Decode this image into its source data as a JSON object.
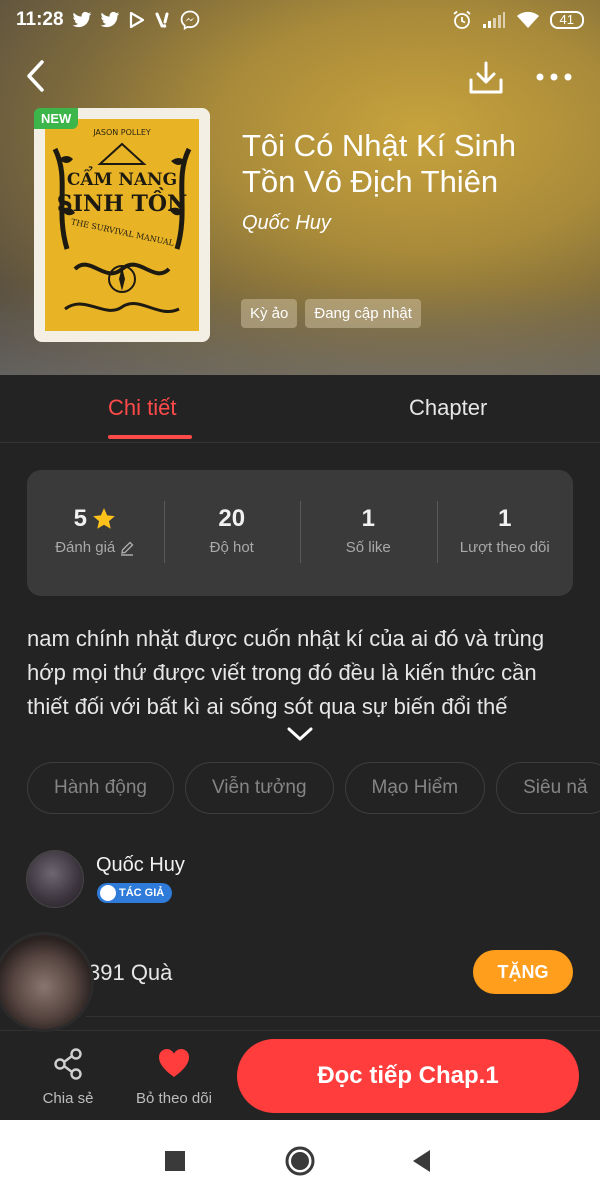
{
  "status_bar": {
    "time": "11:28",
    "battery": "41"
  },
  "book": {
    "badge": "NEW",
    "cover_author": "JASON POLLEY",
    "cover_title_1": "CẨM NANG",
    "cover_title_2": "SINH TỒN",
    "cover_subtitle": "THE SURVIVAL MANUAL",
    "title": "Tôi Có Nhật Kí Sinh Tồn Vô Địch Thiên",
    "author": "Quốc Huy",
    "tags": [
      "Kỳ ảo",
      "Đang cập nhật"
    ]
  },
  "tabs": {
    "details": "Chi tiết",
    "chapter": "Chapter"
  },
  "stats": [
    {
      "value": "5",
      "label": "Đánh giá"
    },
    {
      "value": "20",
      "label": "Độ hot"
    },
    {
      "value": "1",
      "label": "Số like"
    },
    {
      "value": "1",
      "label": "Lượt theo dõi"
    }
  ],
  "description": "nam chính nhặt được cuốn nhật kí của ai đó và trùng hớp mọi thứ được viết trong đó đều là kiến thức cần thiết đối với bất kì ai sống sót qua sự biến đổi thế",
  "genres": [
    "Hành động",
    "Viễn tưởng",
    "Mạo Hiểm",
    "Siêu nă"
  ],
  "author_card": {
    "name": "Quốc Huy",
    "badge": "TÁC GIẢ"
  },
  "gifts": {
    "text": "391 Quà",
    "button": "TẶNG"
  },
  "actions": {
    "share": "Chia sẻ",
    "unfollow": "Bỏ theo dõi",
    "read": "Đọc tiếp Chap.1"
  },
  "colors": {
    "accent": "#ff3d3d",
    "gift": "#ff9d1c",
    "badge_new": "#3cb64a",
    "author_badge": "#2e7bd9"
  }
}
